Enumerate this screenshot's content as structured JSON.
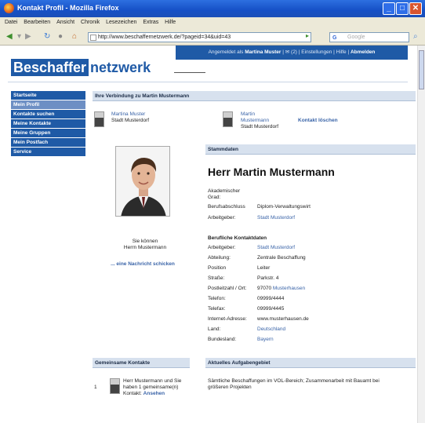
{
  "window": {
    "title": "Kontakt Profil - Mozilla Firefox"
  },
  "menu": [
    "Datei",
    "Bearbeiten",
    "Ansicht",
    "Chronik",
    "Lesezeichen",
    "Extras",
    "Hilfe"
  ],
  "browser": {
    "url": "http://www.beschaffernetzwerk.de/?pageid=34&uid=43",
    "search_placeholder": "Google"
  },
  "site": {
    "logo_part1": "Beschaffer",
    "logo_part2": "netzwerk",
    "topbar": {
      "prefix": "Angemeldet als",
      "user": "Martina Muster",
      "messages": "(2)",
      "settings": "Einstellungen",
      "help": "Hilfe",
      "logout": "Abmelden"
    }
  },
  "sidenav": [
    "Startseite",
    "Mein Profil",
    "Kontakte suchen",
    "Meine Kontakte",
    "Meine Gruppen",
    "Mein Postfach",
    "Service"
  ],
  "connection": {
    "header": "Ihre Verbindung zu Martin Mustermann",
    "from_name": "Martina Muster",
    "from_city": "Stadt Musterdorf",
    "to_name_1": "Martin",
    "to_name_2": "Mustermann",
    "to_city": "Stadt Musterdorf",
    "delete_label": "Kontakt löschen"
  },
  "message": {
    "line1": "Sie können",
    "line2": "Herrn Mustermann",
    "link": "... eine Nachricht schicken"
  },
  "stammdaten": {
    "header": "Stammdaten",
    "name": "Herr Martin Mustermann",
    "akademischer_label_1": "Akademischer",
    "akademischer_label_2": "Grad:",
    "berufsabschluss_label": "Berufsabschluss",
    "berufsabschluss_value": "Diplom-Verwaltungswirt",
    "arbeitgeber_label": "Arbeitgeber:",
    "arbeitgeber_value": "Stadt Musterdorf"
  },
  "kontaktdaten": {
    "header": "Berufliche Kontaktdaten",
    "rows": [
      {
        "k": "Arbeitgeber:",
        "v": "Stadt Musterdorf",
        "link": true
      },
      {
        "k": "Abteilung:",
        "v": "Zentrale Beschaffung",
        "link": false
      },
      {
        "k": "Position",
        "v": "Leiter",
        "link": false
      },
      {
        "k": "Straße:",
        "v": "Parkstr. 4",
        "link": false
      },
      {
        "k": "Postleitzahl / Ort:",
        "v": "97070",
        "v2": "Musterhausen",
        "link": false
      },
      {
        "k": "Telefon:",
        "v": "09999/4444",
        "link": false
      },
      {
        "k": "Telefax:",
        "v": "09999/4445",
        "link": false
      },
      {
        "k": "Internet-Adresse:",
        "v": "www.musterhausen.de",
        "link": false
      },
      {
        "k": "Land:",
        "v": "Deutschland",
        "link": true
      },
      {
        "k": "Bundesland:",
        "v": "Bayern",
        "link": true
      }
    ]
  },
  "gemeinsame": {
    "header": "Gemeinsame Kontakte",
    "index": "1",
    "line1": "Herr Mustermann und Sie",
    "line2": "haben 1 gemeinsame(n)",
    "line3_prefix": "Kontakt:",
    "line3_link": "Ansehen"
  },
  "aufgaben": {
    "header": "Aktuelles Aufgabengebiet",
    "line1": "Sämtliche Beschaffungen im VOL-Bereich; Zusammenarbeit mit Bauamt bei",
    "line2": "größeren Projekten"
  },
  "colors": {
    "brand": "#1f5aa6",
    "section_bg": "#d7e1ee",
    "link": "#3a64a8"
  }
}
